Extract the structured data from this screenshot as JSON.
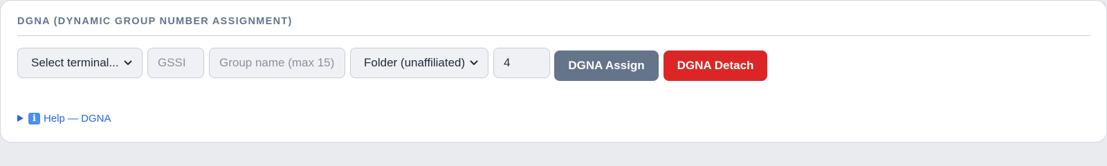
{
  "panel": {
    "title": "DGNA (DYNAMIC GROUP NUMBER ASSIGNMENT)"
  },
  "form": {
    "terminal_select": {
      "value": "Select terminal...",
      "icon": "chevron-down-icon"
    },
    "gssi_input": {
      "value": "",
      "placeholder": "GSSI"
    },
    "group_name_input": {
      "value": "",
      "placeholder": "Group name (max 15)"
    },
    "folder_select": {
      "value": "Folder (unaffiliated)",
      "icon": "chevron-down-icon"
    },
    "number_input": {
      "value": "4"
    },
    "assign_label": "DGNA Assign",
    "detach_label": "DGNA Detach"
  },
  "help": {
    "icon": "info-icon",
    "icon_glyph": "i",
    "label": "Help — DGNA"
  },
  "colors": {
    "assign_button": "#64748b",
    "detach_button": "#dc2626",
    "link": "#2563eb",
    "title": "#64748b"
  }
}
